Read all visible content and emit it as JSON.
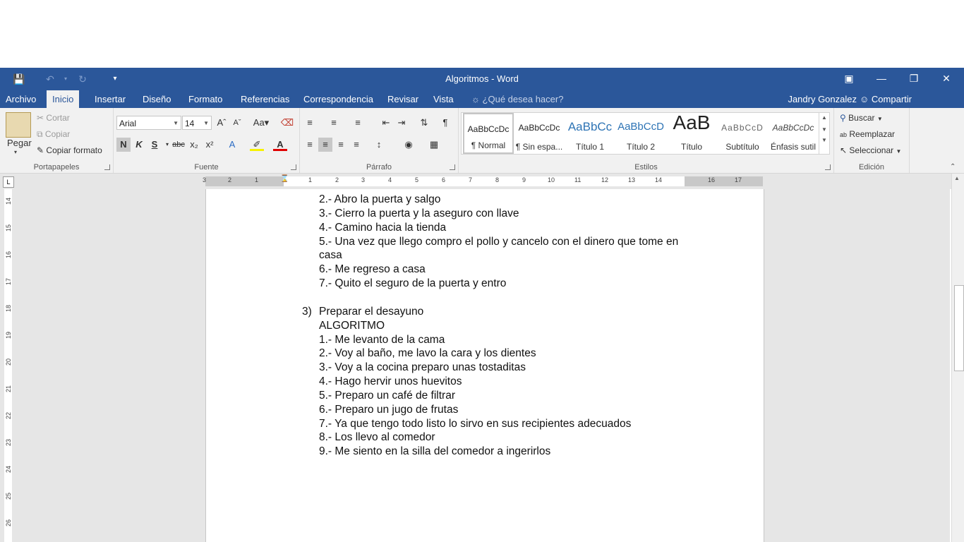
{
  "titlebar": {
    "title": "Algoritmos - Word",
    "quick_access": {
      "save_icon": "save-icon",
      "undo_icon": "undo-icon",
      "redo_icon": "redo-icon",
      "customize_icon": "customize-icon"
    }
  },
  "tabs": [
    "Archivo",
    "Inicio",
    "Insertar",
    "Diseño",
    "Formato",
    "Referencias",
    "Correspondencia",
    "Revisar",
    "Vista"
  ],
  "active_tab": "Inicio",
  "tell_me": "¿Qué desea hacer?",
  "user": "Jandry Gonzalez",
  "share": "Compartir",
  "ribbon": {
    "clipboard": {
      "label": "Portapapeles",
      "paste": "Pegar",
      "cut": "Cortar",
      "copy": "Copiar",
      "format_painter": "Copiar formato"
    },
    "font": {
      "label": "Fuente",
      "font_name": "Arial",
      "font_size": "14",
      "bold": "N",
      "italic": "K",
      "underline": "S",
      "strike": "abc"
    },
    "paragraph": {
      "label": "Párrafo"
    },
    "styles": {
      "label": "Estilos",
      "items": [
        {
          "sample": "AaBbCcDc",
          "name": "¶ Normal"
        },
        {
          "sample": "AaBbCcDc",
          "name": "¶ Sin espa..."
        },
        {
          "sample": "AaBbCc",
          "name": "Título 1"
        },
        {
          "sample": "AaBbCcD",
          "name": "Título 2"
        },
        {
          "sample": "AaB",
          "name": "Título"
        },
        {
          "sample": "AaBbCcD",
          "name": "Subtítulo"
        },
        {
          "sample": "AaBbCcDc",
          "name": "Énfasis sutil"
        }
      ]
    },
    "editing": {
      "label": "Edición",
      "find": "Buscar",
      "replace": "Reemplazar",
      "select": "Seleccionar"
    }
  },
  "ruler_numbers": [
    "3",
    "2",
    "1",
    "1",
    "2",
    "3",
    "4",
    "5",
    "6",
    "7",
    "8",
    "9",
    "10",
    "11",
    "12",
    "13",
    "14",
    "16",
    "17"
  ],
  "vruler_numbers": [
    "14",
    "15",
    "16",
    "17",
    "18",
    "19",
    "20",
    "21",
    "22",
    "23",
    "24",
    "25",
    "26"
  ],
  "document": {
    "lines": [
      "2.- Abro la puerta y salgo",
      "3.- Cierro la puerta y la aseguro con llave",
      "4.- Camino hacia la tienda",
      "5.- Una vez que llego compro el pollo y cancelo con el dinero que tome en",
      "casa",
      "6.- Me regreso a casa",
      "7.- Quito el seguro de la puerta y entro",
      "",
      "Preparar el desayuno",
      "ALGORITMO",
      "1.- Me levanto de la cama",
      "2.- Voy al baño, me lavo la cara y los dientes",
      "3.- Voy a la cocina preparo unas tostaditas",
      "4.- Hago hervir unos huevitos",
      "5.- Preparo un café de filtrar",
      "6.- Preparo un jugo de frutas",
      "7.- Ya que tengo todo listo lo sirvo en sus recipientes adecuados",
      "8.- Los llevo al comedor",
      "9.- Me siento en la silla del comedor a ingerirlos"
    ],
    "list_number": "3)"
  },
  "colors": {
    "brand": "#2b579a",
    "ribbon_bg": "#f1f1f1",
    "doc_bg": "#e6e6e6"
  }
}
